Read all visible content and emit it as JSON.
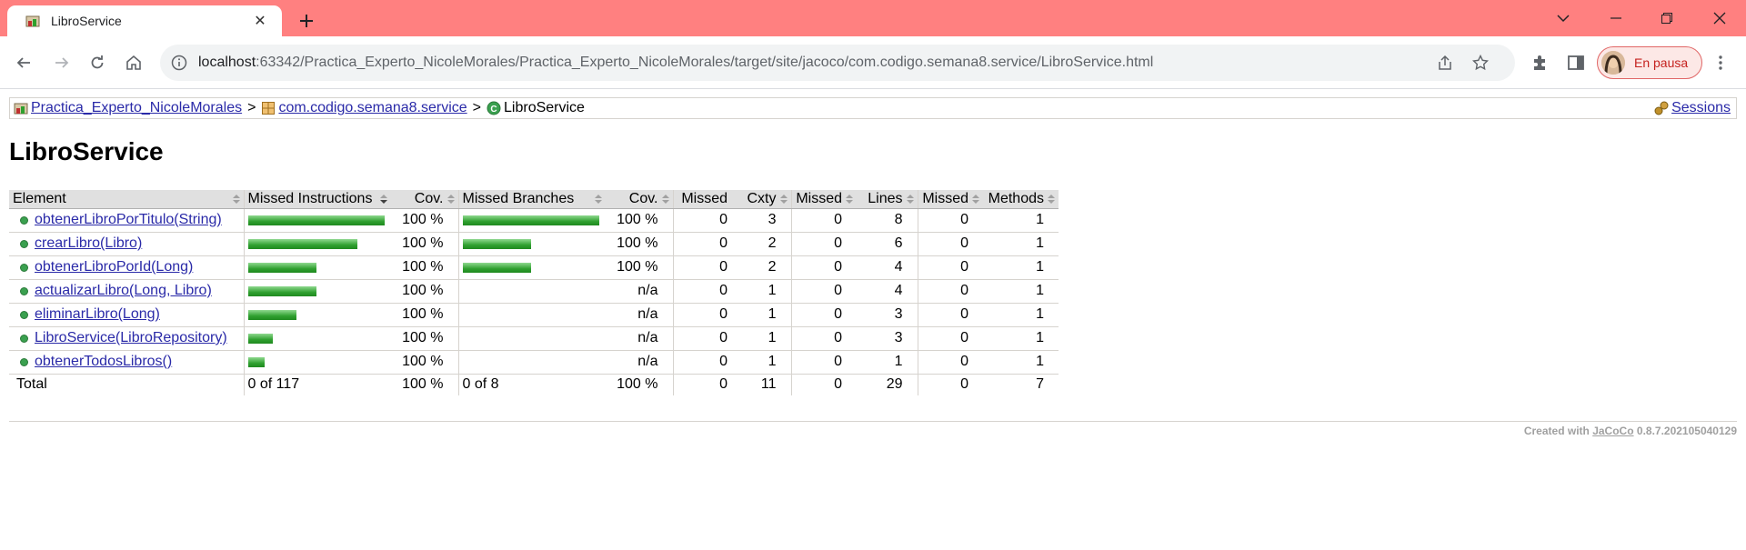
{
  "browser": {
    "tab_title": "LibroService",
    "url_host": "localhost",
    "url_path": ":63342/Practica_Experto_NicoleMorales/Practica_Experto_NicoleMorales/target/site/jacoco/com.codigo.semana8.service/LibroService.html",
    "profile_label": "En pausa",
    "titlebar_color": "#ff8080"
  },
  "breadcrumb": {
    "project": "Practica_Experto_NicoleMorales",
    "sep1": ">",
    "package": "com.codigo.semana8.service",
    "sep2": ">",
    "class": "LibroService",
    "sessions": "Sessions"
  },
  "page_title": "LibroService",
  "table": {
    "headers": [
      "Element",
      "Missed Instructions",
      "Cov.",
      "Missed Branches",
      "Cov.",
      "Missed",
      "Cxty",
      "Missed",
      "Lines",
      "Missed",
      "Methods"
    ],
    "rows": [
      {
        "element": "obtenerLibroPorTitulo(String)",
        "instr_bar": 1.0,
        "instr_cov": "100 %",
        "branch_bar": 1.0,
        "branch_cov": "100 %",
        "missed_cxty": "0",
        "cxty": "3",
        "missed_lines": "0",
        "lines": "8",
        "missed_methods": "0",
        "methods": "1"
      },
      {
        "element": "crearLibro(Libro)",
        "instr_bar": 0.8,
        "instr_cov": "100 %",
        "branch_bar": 0.5,
        "branch_cov": "100 %",
        "missed_cxty": "0",
        "cxty": "2",
        "missed_lines": "0",
        "lines": "6",
        "missed_methods": "0",
        "methods": "1"
      },
      {
        "element": "obtenerLibroPorId(Long)",
        "instr_bar": 0.5,
        "instr_cov": "100 %",
        "branch_bar": 0.5,
        "branch_cov": "100 %",
        "missed_cxty": "0",
        "cxty": "2",
        "missed_lines": "0",
        "lines": "4",
        "missed_methods": "0",
        "methods": "1"
      },
      {
        "element": "actualizarLibro(Long, Libro)",
        "instr_bar": 0.5,
        "instr_cov": "100 %",
        "branch_bar": 0,
        "branch_cov": "n/a",
        "missed_cxty": "0",
        "cxty": "1",
        "missed_lines": "0",
        "lines": "4",
        "missed_methods": "0",
        "methods": "1"
      },
      {
        "element": "eliminarLibro(Long)",
        "instr_bar": 0.35,
        "instr_cov": "100 %",
        "branch_bar": 0,
        "branch_cov": "n/a",
        "missed_cxty": "0",
        "cxty": "1",
        "missed_lines": "0",
        "lines": "3",
        "missed_methods": "0",
        "methods": "1"
      },
      {
        "element": "LibroService(LibroRepository)",
        "instr_bar": 0.18,
        "instr_cov": "100 %",
        "branch_bar": 0,
        "branch_cov": "n/a",
        "missed_cxty": "0",
        "cxty": "1",
        "missed_lines": "0",
        "lines": "3",
        "missed_methods": "0",
        "methods": "1"
      },
      {
        "element": "obtenerTodosLibros()",
        "instr_bar": 0.12,
        "instr_cov": "100 %",
        "branch_bar": 0,
        "branch_cov": "n/a",
        "missed_cxty": "0",
        "cxty": "1",
        "missed_lines": "0",
        "lines": "1",
        "missed_methods": "0",
        "methods": "1"
      }
    ],
    "total": {
      "label": "Total",
      "instr": "0 of 117",
      "instr_cov": "100 %",
      "branch": "0 of 8",
      "branch_cov": "100 %",
      "missed_cxty": "0",
      "cxty": "11",
      "missed_lines": "0",
      "lines": "29",
      "missed_methods": "0",
      "methods": "7"
    }
  },
  "footer": {
    "prefix": "Created with",
    "link": "JaCoCo",
    "version": "0.8.7.202105040129"
  }
}
